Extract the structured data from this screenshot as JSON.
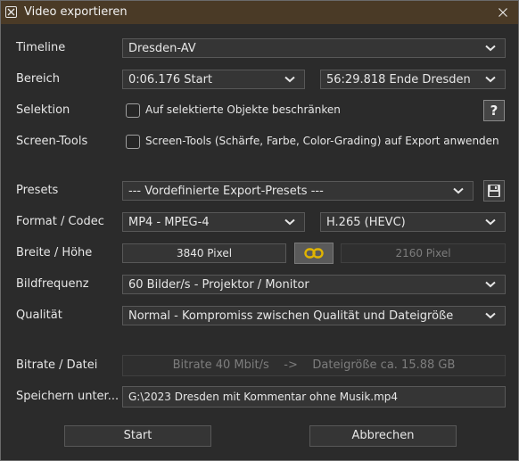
{
  "window": {
    "title": "Video exportieren"
  },
  "labels": {
    "timeline": "Timeline",
    "range": "Bereich",
    "selection": "Selektion",
    "screen_tools": "Screen-Tools",
    "presets": "Presets",
    "format_codec": "Format / Codec",
    "width_height": "Breite / Höhe",
    "framerate": "Bildfrequenz",
    "quality": "Qualität",
    "bitrate_file": "Bitrate / Datei",
    "save_as": "Speichern unter..."
  },
  "timeline": {
    "value": "Dresden-AV"
  },
  "range": {
    "start": "0:06.176  Start",
    "end": "56:29.818  Ende Dresden"
  },
  "selection": {
    "checkbox_label": "Auf selektierte Objekte beschränken",
    "checked": false,
    "help_label": "?"
  },
  "screen_tools": {
    "checkbox_label": "Screen-Tools (Schärfe, Farbe, Color-Grading) auf Export anwenden",
    "checked": false
  },
  "presets": {
    "value": "--- Vordefinierte Export-Presets ---"
  },
  "format": {
    "container": "MP4 - MPEG-4",
    "codec": "H.265 (HEVC)"
  },
  "size": {
    "width": "3840 Pixel",
    "height": "2160 Pixel"
  },
  "framerate": {
    "value": "60 Bilder/s - Projektor / Monitor"
  },
  "quality": {
    "value": "Normal - Kompromiss zwischen Qualität und Dateigröße"
  },
  "bitrate": {
    "value": "Bitrate 40 Mbit/s    ->    Dateigröße ca. 15.88 GB"
  },
  "save_path": {
    "value": "G:\\2023 Dresden mit Kommentar ohne Musik.mp4"
  },
  "buttons": {
    "start": "Start",
    "cancel": "Abbrechen"
  },
  "colors": {
    "titlebar": "#4a3a26",
    "background": "#2b2b2b",
    "field": "#353535",
    "link_accent": "#e0b400"
  }
}
